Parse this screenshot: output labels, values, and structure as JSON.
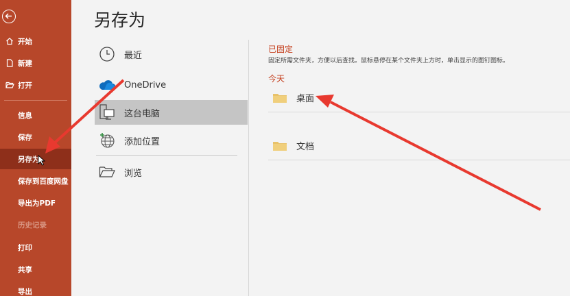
{
  "colors": {
    "sidebar_bg": "#b7472a",
    "sidebar_active": "#8e2f1a",
    "accent_text": "#c43e1c",
    "annotation_arrow": "#e8392f",
    "folder": "#e8c26a"
  },
  "sidebar": {
    "back_icon": "back-arrow-icon",
    "items": [
      {
        "label": "开始",
        "icon": "home-icon"
      },
      {
        "label": "新建",
        "icon": "new-document-icon"
      },
      {
        "label": "打开",
        "icon": "folder-open-icon"
      },
      {
        "label": "信息"
      },
      {
        "label": "保存"
      },
      {
        "label": "另存为",
        "active": true
      },
      {
        "label": "保存到百度网盘"
      },
      {
        "label": "导出为PDF"
      },
      {
        "label": "历史记录",
        "disabled": true
      },
      {
        "label": "打印"
      },
      {
        "label": "共享"
      },
      {
        "label": "导出"
      }
    ]
  },
  "main": {
    "title": "另存为",
    "locations": [
      {
        "label": "最近",
        "icon": "clock-icon"
      },
      {
        "label": "OneDrive",
        "icon": "onedrive-cloud-icon"
      },
      {
        "label": "这台电脑",
        "icon": "computer-icon",
        "selected": true
      },
      {
        "label": "添加位置",
        "icon": "add-globe-icon"
      },
      {
        "label": "浏览",
        "icon": "folder-browse-icon"
      }
    ],
    "pinned_title": "已固定",
    "pinned_desc": "固定所需文件夹，方便以后查找。鼠标悬停在某个文件夹上方时，单击显示的图钉图标。",
    "today_title": "今天",
    "folders": [
      {
        "name": "桌面",
        "icon": "folder-icon"
      },
      {
        "name": "文档",
        "icon": "folder-icon"
      }
    ]
  }
}
